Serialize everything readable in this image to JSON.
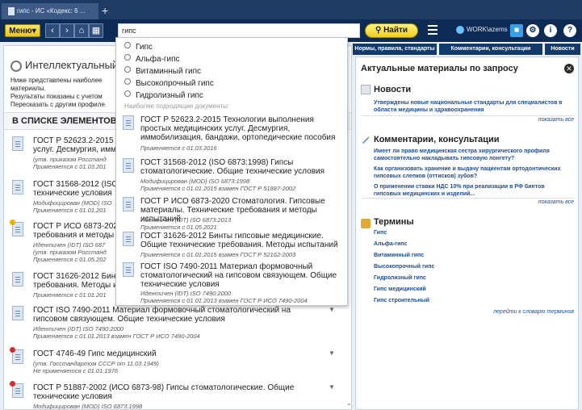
{
  "tabbar": {
    "tab_title": "гипс - ИС «Кодекс: 6 ...",
    "new_tab": "+"
  },
  "toolbar": {
    "menu_label": "Меню▾",
    "search_value": "гипс",
    "find_label": "Найти",
    "user": "WORK\\azems"
  },
  "left": {
    "title": "Интеллектуальный п",
    "intro": [
      "Ниже представлены наиболее",
      "материалы.",
      "Результаты показаны с учетом",
      "Пересказать с другим профиле"
    ],
    "section_title": "В СПИСКЕ ЭЛЕМЕНТОВ:",
    "results": [
      {
        "title": "ГОСТ Р 52623.2-2015 Т\nуслуг. Десмургия, имм",
        "meta": [
          "(утв. приказом Росстанд",
          "Применяется с 01.03.201"
        ],
        "flag": ""
      },
      {
        "title": "ГОСТ 31568-2012 (ISO\nтехнические условия",
        "meta": [
          "Модифицирован (MOD) ISO",
          "Применяется с 01.01.201"
        ],
        "flag": ""
      },
      {
        "title": "ГОСТ Р ИСО 6873-202\nтребования и методы и",
        "meta": [
          "Идентичен (IDT) ISO 687",
          "(утв. приказом Росстанд",
          "Применяется с 01.05.202"
        ],
        "flag": "yellow"
      },
      {
        "title": "ГОСТ 31626-2012 Бинт\nтребования. Методы и",
        "meta": [
          "Применяется с 01.01.201"
        ],
        "flag": ""
      },
      {
        "title": "ГОСТ ISO 7490-2011 Материал формовочный стоматологический на\nгипсовом связующем. Общие технические условия",
        "meta": [
          "Идентичен (IDT) ISO 7490:2000",
          "Применяется с 01.01.2013 взамен ГОСТ Р ИСО 7490-2004"
        ],
        "flag": ""
      },
      {
        "title": "ГОСТ 4746-49 Гипс медицинский",
        "meta": [
          "(утв. Госстандартом СССР от 11.03.1949)",
          "Не применяется с 01.01.1976"
        ],
        "flag": "red"
      },
      {
        "title": "ГОСТ Р 51887-2002 (ИСО 6873-98) Гипсы стоматологические. Общие\nтехнические условия",
        "meta": [
          "Модифицирован (MOD) ISO 6873:1998"
        ],
        "flag": "red"
      }
    ]
  },
  "dropdown": {
    "suggestions": [
      "Гипс",
      "Альфа-гипс",
      "Витаминный гипс",
      "Высокопрочный гипс",
      "Гидролизный гипс"
    ],
    "section_label": "Наиболее подходящие документы:",
    "docs": [
      {
        "title": "ГОСТ Р 52623.2-2015 Технологии выполнения простых медицинских услуг. Десмургия, иммобилизация, бандажи, ортопедические пособия",
        "meta": [
          "Применяется с 01.03.2016"
        ]
      },
      {
        "title": "ГОСТ 31568-2012 (ISO 6873:1998) Гипсы стоматологические. Общие технические условия",
        "meta": [
          "Модифицирован (MOD) ISO 6873:1998",
          "Применяется с 01.01.2015 взамен ГОСТ Р 51887-2002"
        ]
      },
      {
        "title": "ГОСТ Р ИСО 6873-2020 Стоматология. Гипсовые материалы. Технические требования и методы испытаний",
        "meta": [
          "Идентичен (IDT) ISO 6873:2013",
          "Применяется с 01.05.2021"
        ]
      },
      {
        "title": "ГОСТ 31626-2012 Бинты гипсовые медицинские. Общие технические требования. Методы испытаний",
        "meta": [
          "Применяется с 01.01.2015 взамен ГОСТ Р 52162-2003"
        ]
      },
      {
        "title": "ГОСТ ISO 7490-2011 Материал формовочный стоматологический на гипсовом связующем. Общие технические условия",
        "meta": [
          "Идентичен (IDT) ISO 7490:2000",
          "Применяется с 01.01.2013 взамен ГОСТ Р ИСО 7490-2004"
        ]
      }
    ]
  },
  "right_tabs": [
    "Нормы, правила, стандарты",
    "Комментарии, консультации",
    "Новости"
  ],
  "right": {
    "title": "Актуальные материалы по запросу",
    "news_title": "Новости",
    "news_link": "Утверждены новые национальные стандарты для специалистов в области медицины и здравоохранения",
    "show_all": "показать все",
    "comments_title": "Комментарии, консультации",
    "comments": [
      "Имеет ли право медицинская сестра хирургического профиля самостоятельно накладывать гипсовую лонгету?",
      "Как организовать хранение и выдачу пациентам ортодонтических гипсовых слепков (оттисков) зубов?",
      "О применении ставки НДС 10% при реализации в РФ бинтов гипсовых медицинских и изделий..."
    ],
    "terms_title": "Термины",
    "terms": [
      "Гипс",
      "Альфа-гипс",
      "Витаминный гипс",
      "Высокопрочный гипс",
      "Гидролизный гипс",
      "Гипс медицинский",
      "Гипс строительный"
    ],
    "dictionary_link": "перейти к словарю терминов"
  }
}
